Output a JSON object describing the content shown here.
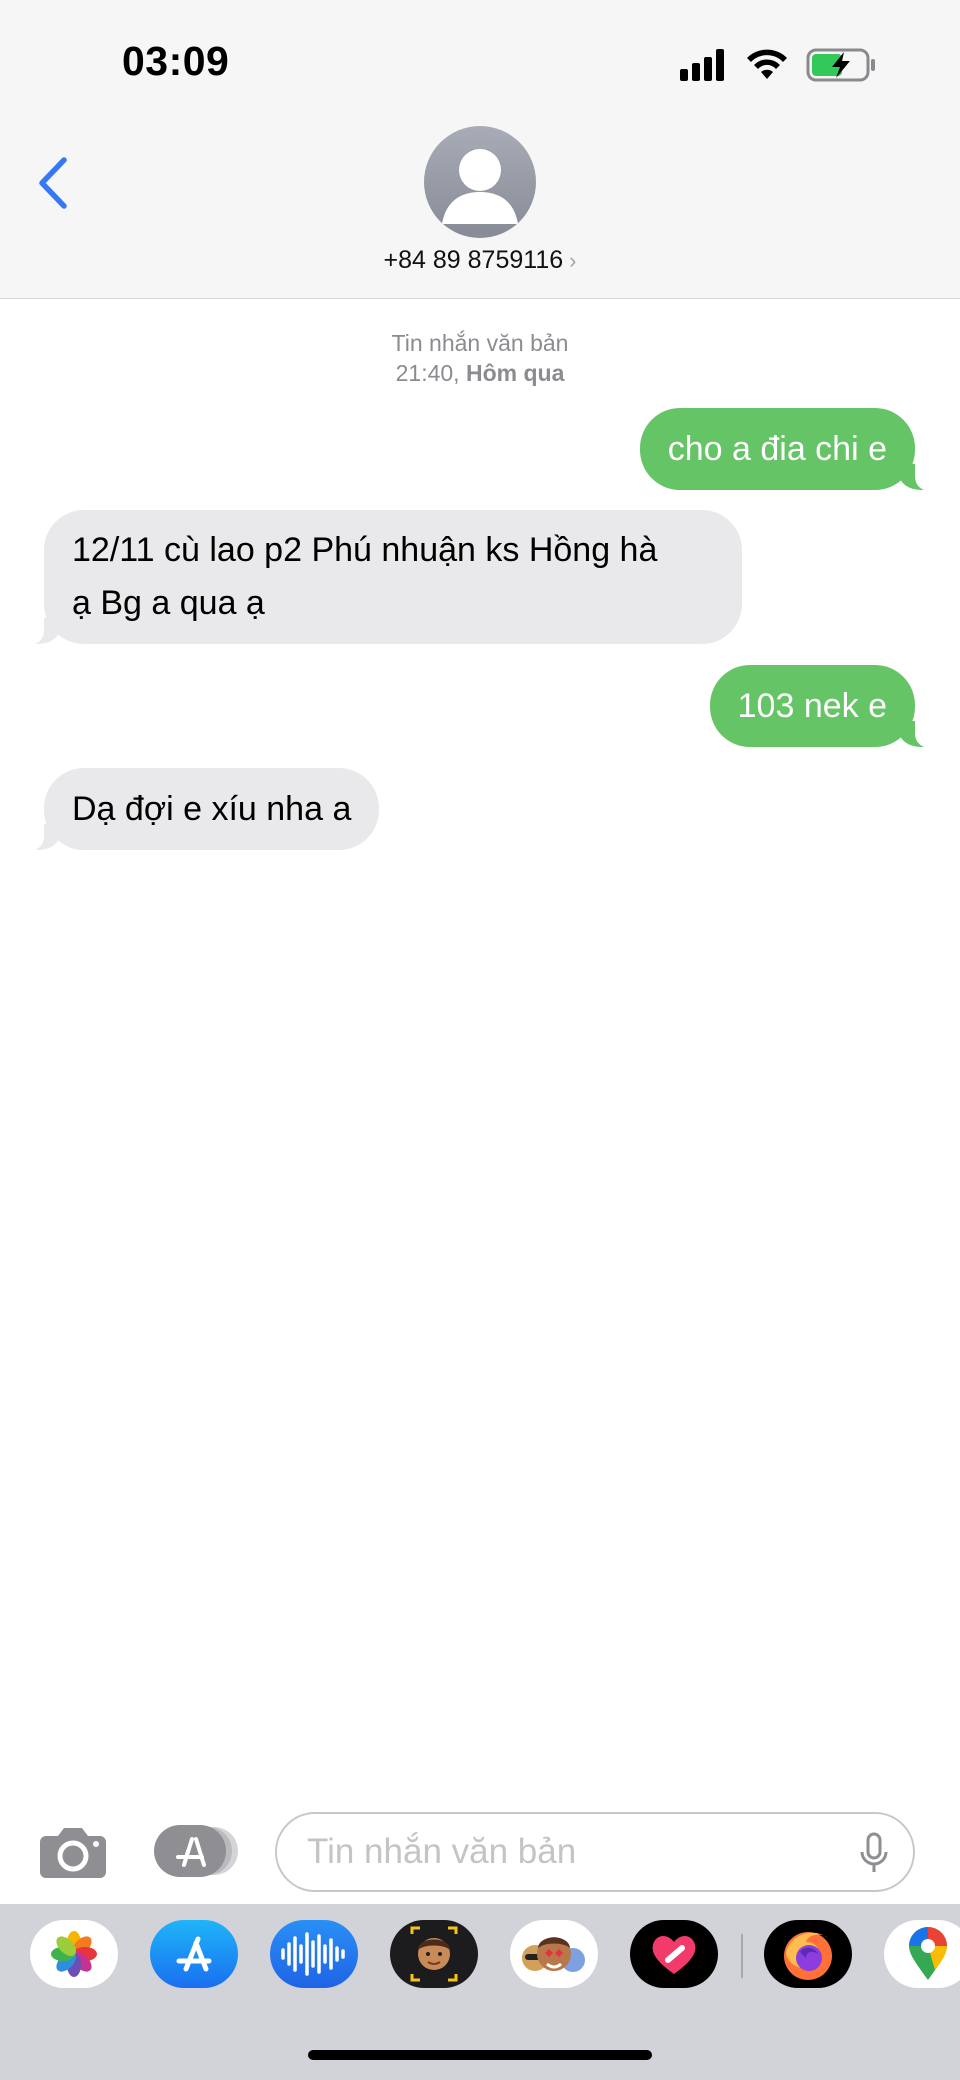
{
  "status_bar": {
    "time": "03:09"
  },
  "header": {
    "contact": "+84 89 8759116",
    "contact_chevron": "›"
  },
  "thread": {
    "meta_label": "Tin nhắn văn bản",
    "meta_time": "21:40,",
    "meta_day": "Hôm qua"
  },
  "messages": [
    {
      "direction": "out",
      "text": "cho a đia chi e"
    },
    {
      "direction": "in",
      "text_line1": "12/11 cù lao p2 Phú nhuận ks Hồng hà",
      "text_line2": "ạ Bg a qua ạ"
    },
    {
      "direction": "out",
      "text": "103 nek e"
    },
    {
      "direction": "in",
      "text": "Dạ đợi e xíu nha a"
    }
  ],
  "input": {
    "placeholder": "Tin nhắn văn bản"
  },
  "icons": {
    "back": "chevron-left-icon",
    "camera": "camera-icon",
    "apps": "app-store-icon",
    "mic": "microphone-icon"
  },
  "app_tray": [
    "photos",
    "app-store",
    "audio-message",
    "memoji",
    "animoji-stickers",
    "digital-touch",
    "firefox",
    "google-maps"
  ],
  "colors": {
    "outgoing_bubble": "#65c466",
    "incoming_bubble": "#e9e9eb",
    "accent": "#3478f6"
  }
}
